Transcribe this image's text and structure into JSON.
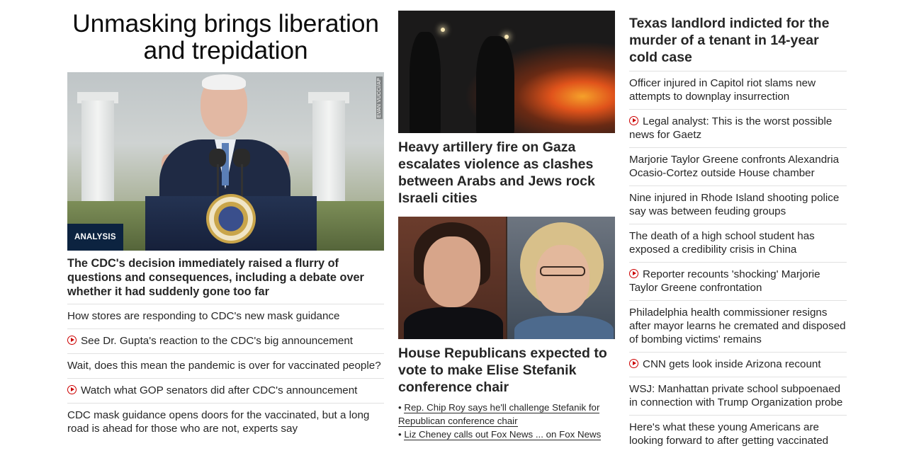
{
  "col1": {
    "lead_title": "Unmasking brings liberation and trepidation",
    "photo_credit": "EVAN VUCCI/AP",
    "badge": "ANALYSIS",
    "lead_desc": "The CDC's decision immediately raised a flurry of questions and consequences, including a debate over whether it had suddenly gone too far",
    "items": [
      {
        "text": "How stores are responding to CDC's new mask guidance",
        "video": false
      },
      {
        "text": "See Dr. Gupta's reaction to the CDC's big announcement",
        "video": true
      },
      {
        "text": "Wait, does this mean the pandemic is over for vaccinated people?",
        "video": false
      },
      {
        "text": "Watch what GOP senators did after CDC's announcement",
        "video": true
      },
      {
        "text": "CDC mask guidance opens doors for the vaccinated, but a long road is ahead for those who are not, experts say",
        "video": false
      }
    ]
  },
  "col2": {
    "story1_title": "Heavy artillery fire on Gaza escalates violence as clashes between Arabs and Jews rock Israeli cities",
    "story2_title": "House Republicans expected to vote to make Elise Stefanik conference chair",
    "related": [
      "Rep. Chip Roy says he'll challenge Stefanik for Republican conference chair",
      "Liz Cheney calls out Fox News ... on Fox News"
    ]
  },
  "col3": {
    "headline": "Texas landlord indicted for the murder of a tenant in 14-year cold case",
    "items": [
      {
        "text": "Officer injured in Capitol riot slams new attempts to downplay insurrection",
        "video": false
      },
      {
        "text": "Legal analyst: This is the worst possible news for Gaetz",
        "video": true
      },
      {
        "text": "Marjorie Taylor Greene confronts Alexandria Ocasio-Cortez outside House chamber",
        "video": false
      },
      {
        "text": "Nine injured in Rhode Island shooting police say was between feuding groups",
        "video": false
      },
      {
        "text": "The death of a high school student has exposed a credibility crisis in China",
        "video": false
      },
      {
        "text": "Reporter recounts 'shocking' Marjorie Taylor Greene confrontation",
        "video": true
      },
      {
        "text": "Philadelphia health commissioner resigns after mayor learns he cremated and disposed of bombing victims' remains",
        "video": false
      },
      {
        "text": "CNN gets look inside Arizona recount",
        "video": true
      },
      {
        "text": "WSJ: Manhattan private school subpoenaed in connection with Trump Organization probe",
        "video": false
      },
      {
        "text": "Here's what these young Americans are looking forward to after getting vaccinated",
        "video": false
      }
    ]
  },
  "colors": {
    "video_icon": "#cc0000",
    "badge_bg": "#0c2340",
    "divider": "#e1e1e1",
    "text": "#262626"
  },
  "icons": {
    "video": "play-circle-icon"
  }
}
